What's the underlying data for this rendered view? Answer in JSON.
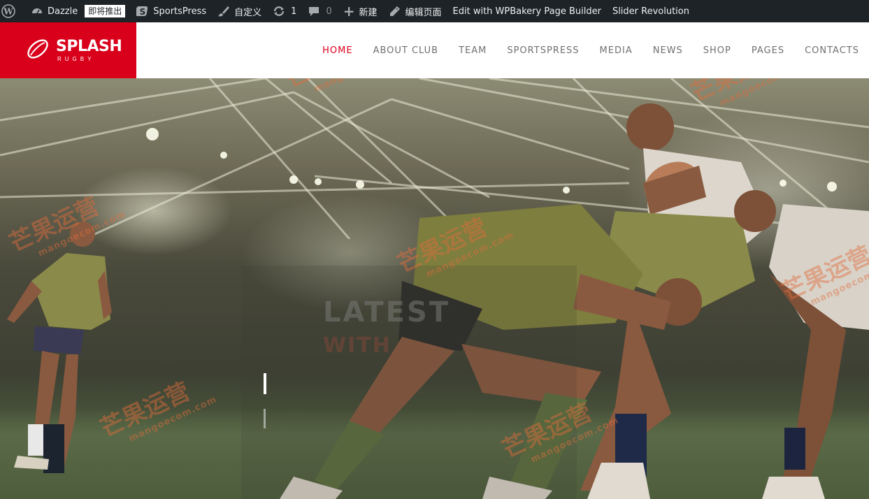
{
  "admin_bar": {
    "site_name": "Dazzle",
    "badge": "即将推出",
    "sportspress": "SportsPress",
    "customize": "自定义",
    "updates_count": "1",
    "comments_count": "0",
    "new": "新建",
    "edit_page": "编辑页面",
    "wpbakery": "Edit with WPBakery Page Builder",
    "slider_revolution": "Slider Revolution"
  },
  "logo": {
    "main": "SPLASH",
    "sub": "RUGBY"
  },
  "nav": [
    "HOME",
    "ABOUT CLUB",
    "TEAM",
    "SPORTSPRESS",
    "MEDIA",
    "NEWS",
    "SHOP",
    "PAGES",
    "CONTACTS"
  ],
  "hero": {
    "headline": "LATEST",
    "subheadline": "WITH"
  },
  "watermark": {
    "text": "芒果运营",
    "url": "mangoecom.com"
  },
  "colors": {
    "brand_red": "#d9001b",
    "admin_bar": "#1d2327",
    "nav_text": "#707070"
  }
}
